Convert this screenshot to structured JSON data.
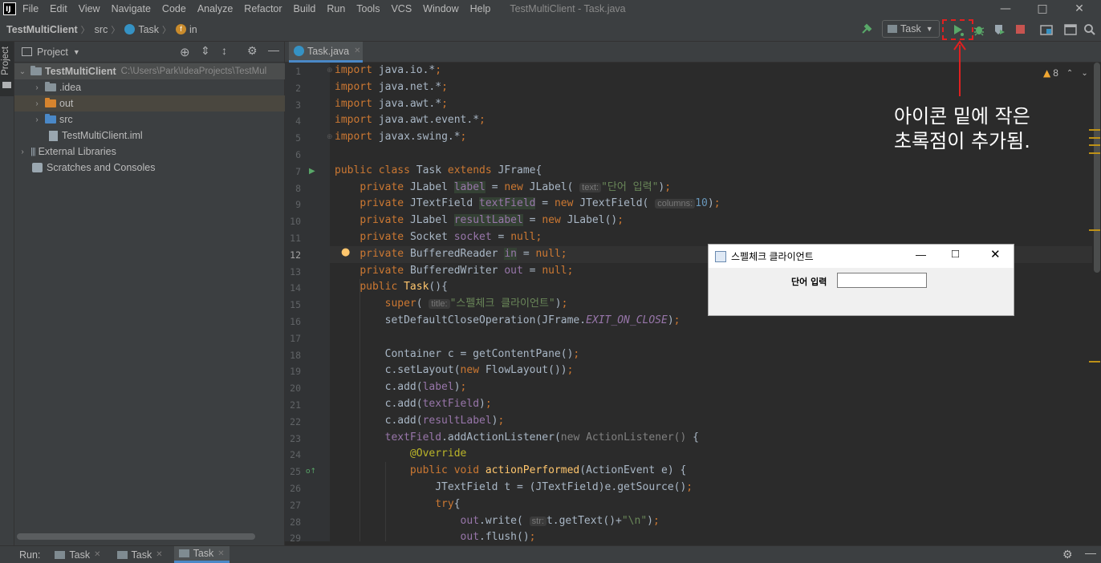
{
  "menubar": {
    "logo": "IJ",
    "items": [
      "File",
      "Edit",
      "View",
      "Navigate",
      "Code",
      "Analyze",
      "Refactor",
      "Build",
      "Run",
      "Tools",
      "VCS",
      "Window",
      "Help"
    ],
    "window_title": "TestMultiClient - Task.java"
  },
  "navbar": {
    "crumbs": [
      "TestMultiClient",
      "src",
      "Task",
      "in"
    ],
    "run_config": "Task"
  },
  "sidebar_tab": "Project",
  "project": {
    "title": "Project",
    "root_name": "TestMultiClient",
    "root_path": "C:\\Users\\Park\\IdeaProjects\\TestMul",
    "items": [
      ".idea",
      "out",
      "src",
      "TestMultiClient.iml"
    ],
    "external": "External Libraries",
    "scratches": "Scratches and Consoles"
  },
  "editor": {
    "tab": "Task.java",
    "warnings": "8",
    "hints": {
      "text": "text:",
      "columns": "columns:",
      "title": "title:",
      "str": "str:"
    },
    "line_numbers": [
      "1",
      "2",
      "3",
      "4",
      "5",
      "6",
      "7",
      "8",
      "9",
      "10",
      "11",
      "12",
      "13",
      "14",
      "15",
      "16",
      "17",
      "18",
      "19",
      "20",
      "21",
      "22",
      "23",
      "24",
      "25",
      "26",
      "27",
      "28",
      "29"
    ],
    "code": {
      "l1": "import java.io.*;",
      "l2": "import java.net.*;",
      "l3": "import java.awt.*;",
      "l4": "import java.awt.event.*;",
      "l5": "import javax.swing.*;",
      "l7_a": "public class ",
      "l7_b": "Task ",
      "l7_c": "extends ",
      "l7_d": "JFrame{",
      "str_input": "\"단어 입력\"",
      "num_10": "10",
      "str_title": "\"스펠체크 클라이언트\"",
      "str_newline": "\"\\n\""
    }
  },
  "dialog": {
    "title": "스펠체크 클라이언트",
    "label": "단어 입력",
    "field_value": ""
  },
  "annotation": {
    "line1": "아이콘 밑에 작은",
    "line2": "초록점이 추가됨."
  },
  "bottombar": {
    "run_label": "Run:",
    "tabs": [
      "Task",
      "Task",
      "Task"
    ]
  },
  "colors": {
    "run_green": "#59a869",
    "stop_red": "#c75450",
    "annotation_red": "#e02020"
  }
}
